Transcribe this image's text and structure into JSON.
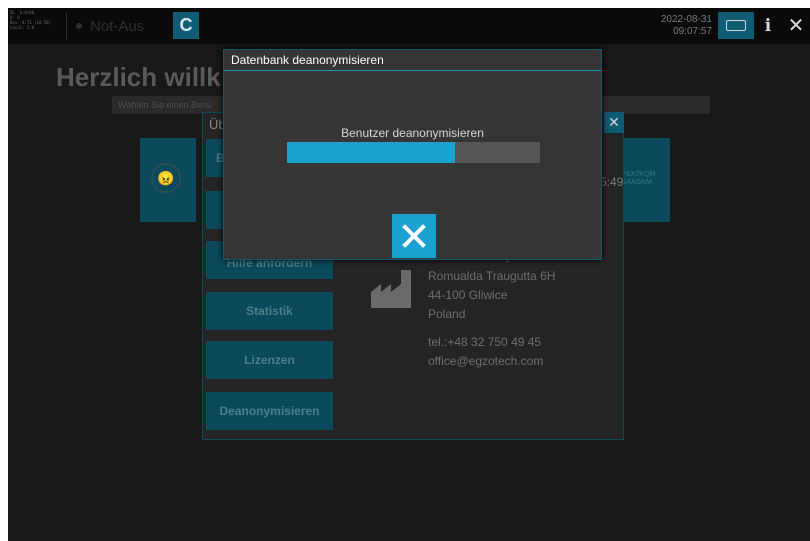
{
  "topbar": {
    "info_text": "BL. 0:Wc00\nU: 0\nDev: 0.71 (10:50)\nLocal: 5.0",
    "estop_label": "Not-Aus",
    "app_button_label": "C",
    "date": "2022-08-31",
    "time": "09:07:57",
    "icons": {
      "keyboard": "keyboard-icon",
      "info": "info-icon",
      "close": "close-icon"
    },
    "info_label": "i",
    "close_label": "✕"
  },
  "background": {
    "welcome_title": "Herzlich willk",
    "search_placeholder": "Wählen Sie einen Benu",
    "tile_code_line1": "7SX7KQM",
    "tile_code_line2": "S4AGNM",
    "face_icon": "angry-face-icon",
    "face_glyph": "😠"
  },
  "about_dialog": {
    "title": "Üb",
    "close_label": "✕",
    "side_buttons": [
      {
        "label": "B"
      },
      {
        "label": ""
      },
      {
        "label": "Hilfe anfordern"
      },
      {
        "label": "Statistik"
      },
      {
        "label": "Lizenzen"
      },
      {
        "label": "Deanonymisieren"
      }
    ],
    "time_fragment": "5:49",
    "company_partial": "EGZOTECH Sp z o.o.",
    "address": [
      "Romualda Traugutta 6H",
      "44-100 Gliwice",
      "Poland"
    ],
    "phone": "tel.:+48 32 750 49 45",
    "email": "office@egzotech.com",
    "factory_icon": "factory-icon"
  },
  "modal": {
    "title": "Datenbank deanonymisieren",
    "progress_label": "Benutzer deanonymisieren",
    "progress_fraction": 0.665,
    "close_icon": "close-icon"
  },
  "colors": {
    "accent": "#1aa1d0",
    "accent_dark": "#0b4a5c",
    "modal_bg": "#353535",
    "screen_bg": "#181818"
  }
}
